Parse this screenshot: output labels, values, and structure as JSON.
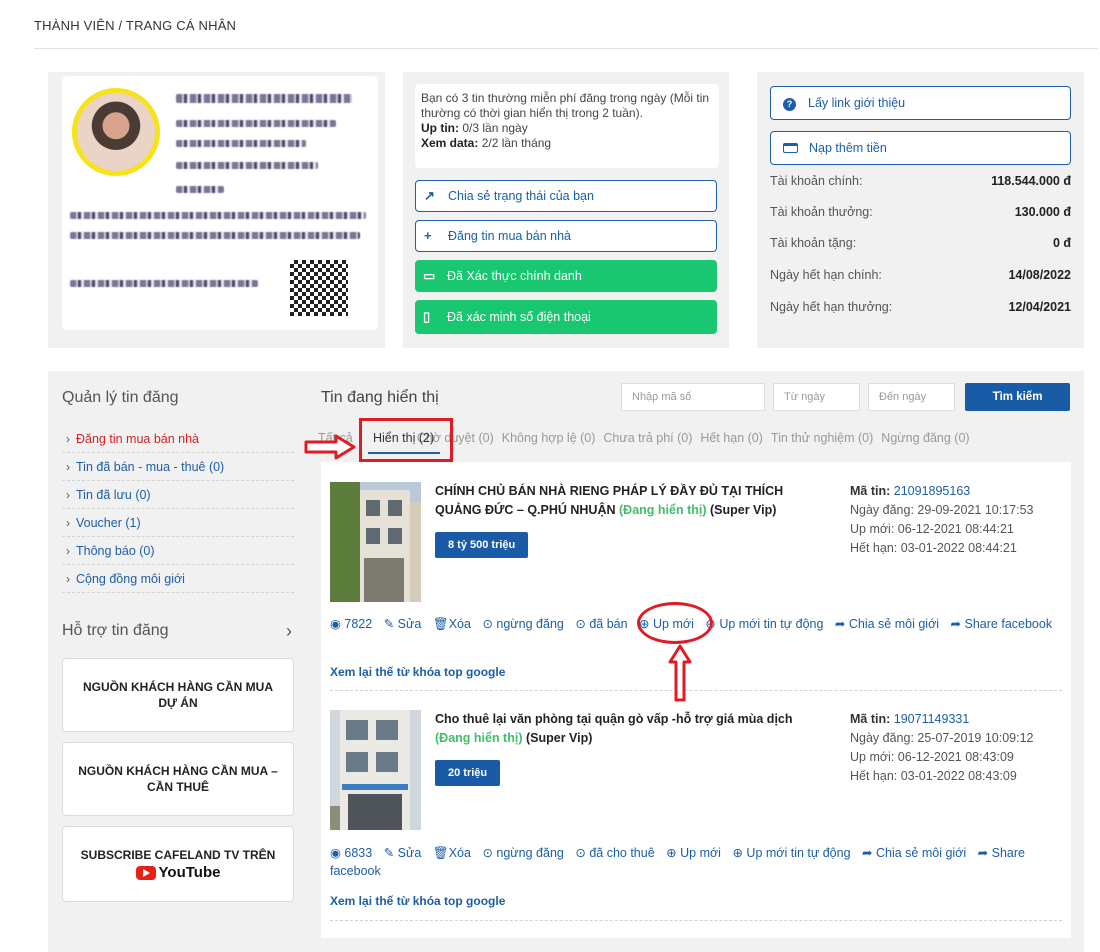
{
  "breadcrumb": "THÀNH VIÊN / TRANG CÁ NHÂN",
  "info": {
    "text": "Bạn có 3 tin thường miễn phí đăng trong ngày (Mỗi tin thường có thời gian hiển thị trong 2 tuần).",
    "up_label": "Up tin:",
    "up_value": "0/3 lần ngày",
    "data_label": "Xem data:",
    "data_value": "2/2 lần tháng",
    "share_status": "Chia sẻ trạng thái của bạn",
    "post_listing": "Đăng tin mua bán nhà",
    "verified_identity": "Đã Xác thực chính danh",
    "verified_phone": "Đã xác minh số điện thoại"
  },
  "wallet": {
    "referral_button": "Lấy link giới thiệu",
    "topup_button": "Nạp thêm tiền",
    "rows": [
      {
        "label": "Tài khoản chính:",
        "value": "118.544.000 đ"
      },
      {
        "label": "Tài khoản thưởng:",
        "value": "130.000 đ"
      },
      {
        "label": "Tài khoản tặng:",
        "value": "0 đ"
      },
      {
        "label": "Ngày hết hạn chính:",
        "value": "14/08/2022"
      },
      {
        "label": "Ngày hết hạn thưởng:",
        "value": "12/04/2021"
      }
    ]
  },
  "sidebar": {
    "title": "Quản lý tin đăng",
    "items": [
      "Đăng tin mua bán nhà",
      "Tin đã bán - mua - thuê (0)",
      "Tin đã lưu (0)",
      "Voucher (1)",
      "Thông báo (0)",
      "Cộng đồng môi giới"
    ],
    "support_title": "Hỗ trợ tin đăng",
    "promo1": "NGUỒN KHÁCH HÀNG CẦN MUA DỰ ÁN",
    "promo2": "NGUỒN KHÁCH HÀNG CẦN MUA – CẦN THUÊ",
    "promo3": "SUBSCRIBE CAFELAND TV TRÊN",
    "youtube": "YouTube"
  },
  "main": {
    "title": "Tin đang hiển thị",
    "code_placeholder": "Nhập mã số",
    "from_placeholder": "Từ ngày",
    "to_placeholder": "Đến ngày",
    "search_button": "Tìm kiếm",
    "tabs": {
      "all": "Tất cả",
      "active": "Hiển thị (2)",
      "pending": "Chờ duyệt (0)",
      "invalid": "Không hợp lệ (0)",
      "unpaid": "Chưa trả phí (0)",
      "expired": "Hết hạn (0)",
      "trial": "Tin thử nghiệm (0)",
      "stopped": "Ngừng đăng (0)"
    },
    "listings": [
      {
        "title": "CHÍNH CHỦ BÁN NHÀ RIENG PHÁP LÝ ĐẦY ĐỦ TẠI THÍCH QUẢNG ĐỨC – Q.PHÚ NHUẬN",
        "status": "(Đang hiển thị)",
        "tier": "(Super Vip)",
        "price": "8 tỷ 500 triệu",
        "code_label": "Mã tin:",
        "code": "21091895163",
        "posted": "Ngày đăng: 29-09-2021 10:17:53",
        "upped": "Up mới: 06-12-2021 08:44:21",
        "expires": "Hết hạn: 03-01-2022 08:44:21",
        "views": "7822",
        "edit": "Sửa",
        "delete": "Xóa",
        "stop": "ngừng đăng",
        "done": "đã bán",
        "up": "Up mới",
        "auto_up": "Up mới tin tự động",
        "share_broker": "Chia sẻ môi giới",
        "share_fb": "Share facebook",
        "keywords": "Xem lại thế từ khóa top google"
      },
      {
        "title": "Cho thuê lại văn phòng tại quận gò vấp -hỗ trợ giá mùa dịch",
        "status": "(Đang hiển thị)",
        "tier": "(Super Vip)",
        "price": "20 triệu",
        "code_label": "Mã tin:",
        "code": "19071149331",
        "posted": "Ngày đăng: 25-07-2019 10:09:12",
        "upped": "Up mới: 06-12-2021 08:43:09",
        "expires": "Hết hạn: 03-01-2022 08:43:09",
        "views": "6833",
        "edit": "Sửa",
        "delete": "Xóa",
        "stop": "ngừng đăng",
        "done": "đã cho thuê",
        "up": "Up mới",
        "auto_up": "Up mới tin tự động",
        "share_broker": "Chia sẻ môi giới",
        "share_fb": "Share facebook",
        "keywords": "Xem lại thế từ khóa top google"
      }
    ]
  },
  "colors": {
    "accent": "#1c5ea8",
    "green": "#18c76f",
    "annotation": "#e01b24"
  }
}
